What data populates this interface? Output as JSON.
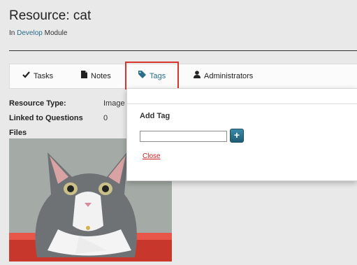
{
  "header": {
    "title": "Resource: cat",
    "subtitle_prefix": "In",
    "module_link": "Develop",
    "subtitle_suffix": "Module"
  },
  "tabs": [
    {
      "label": "Tasks",
      "icon": "check-icon"
    },
    {
      "label": "Notes",
      "icon": "document-icon"
    },
    {
      "label": "Tags",
      "icon": "tag-icon",
      "active": true
    },
    {
      "label": "Administrators",
      "icon": "user-icon"
    }
  ],
  "details": {
    "resource_type_label": "Resource Type:",
    "resource_type_value": "Image",
    "linked_label": "Linked to Questions",
    "linked_value": "0",
    "files_label": "Files"
  },
  "files": {
    "image": "gray-and-white-kitten-photo"
  },
  "popup": {
    "title": "Add Tag",
    "input_value": "",
    "add_icon": "plus-icon",
    "close_label": "Close"
  },
  "colors": {
    "link": "#2a6f8a",
    "highlight": "#d9342b",
    "close": "#cc2222",
    "add_button": "#2b7491"
  }
}
